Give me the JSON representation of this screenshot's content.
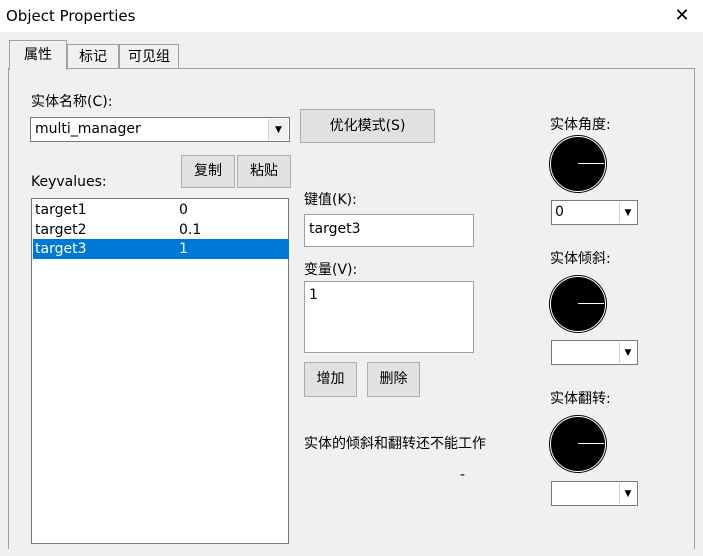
{
  "window": {
    "title": "Object Properties",
    "close_glyph": "✕"
  },
  "tabs": [
    {
      "label": "属性",
      "active": true
    },
    {
      "label": "标记",
      "active": false
    },
    {
      "label": "可见组",
      "active": false
    }
  ],
  "entity_name": {
    "label": "实体名称(C):",
    "value": "multi_manager"
  },
  "smart_mode_button": "优化模式(S)",
  "copy_button": "复制",
  "paste_button": "粘贴",
  "keyvalues": {
    "label": "Keyvalues:",
    "rows": [
      {
        "key": "target1",
        "value": "0",
        "selected": false
      },
      {
        "key": "target2",
        "value": "0.1",
        "selected": false
      },
      {
        "key": "target3",
        "value": "1",
        "selected": true
      }
    ]
  },
  "key_field": {
    "label": "键值(K):",
    "value": "target3"
  },
  "value_field": {
    "label": "变量(V):",
    "value": "1"
  },
  "add_button": "增加",
  "delete_button": "删除",
  "note": "实体的倾斜和翻转还不能工作",
  "dash": "-",
  "angle": {
    "label": "实体角度:",
    "value": "0"
  },
  "pitch": {
    "label": "实体倾斜:",
    "value": ""
  },
  "roll": {
    "label": "实体翻转:",
    "value": ""
  },
  "colors": {
    "selection": "#0078d7",
    "dial": "#000000"
  }
}
